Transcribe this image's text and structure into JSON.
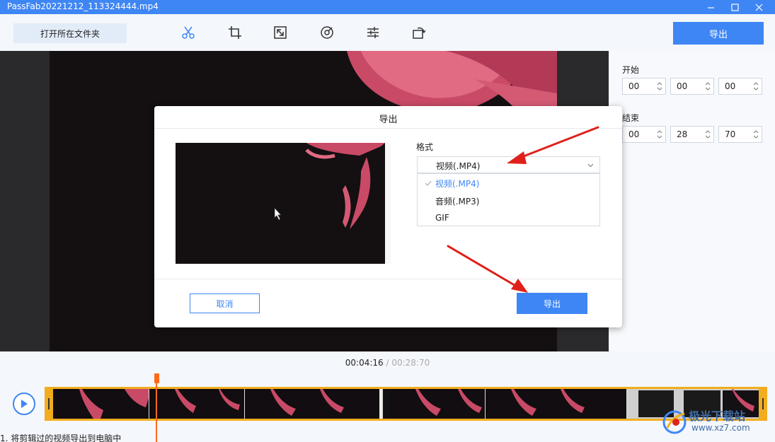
{
  "window": {
    "title": "PassFab20221212_113324444.mp4"
  },
  "toolbar": {
    "open_folder_label": "打开所在文件夹",
    "export_label": "导出",
    "tools": [
      "scissors-icon",
      "crop-icon",
      "resize-icon",
      "speed-icon",
      "adjust-icon",
      "rotate-icon"
    ]
  },
  "right_panel": {
    "start_label": "开始",
    "start": [
      "00",
      "00",
      "00"
    ],
    "end_label": "结束",
    "end": [
      "00",
      "28",
      "70"
    ]
  },
  "timeline": {
    "current_time": "00:04:16",
    "separator": " / ",
    "total_time": "00:28:70"
  },
  "dialog": {
    "title": "导出",
    "format_label": "格式",
    "selected_format": "视频(.MP4)",
    "options": [
      "视频(.MP4)",
      "音频(.MP3)",
      "GIF"
    ],
    "cancel_label": "取消",
    "export_label": "导出"
  },
  "watermark": {
    "line1": "极光下载站",
    "line2": "www.xz7.com"
  },
  "bottom_caption": "1. 将剪辑过的视频导出到电脑中",
  "colors": {
    "accent": "#3f86f5",
    "track_border": "#f2ad1f",
    "playhead": "#ff6a1a",
    "arrow": "#e0201a"
  }
}
